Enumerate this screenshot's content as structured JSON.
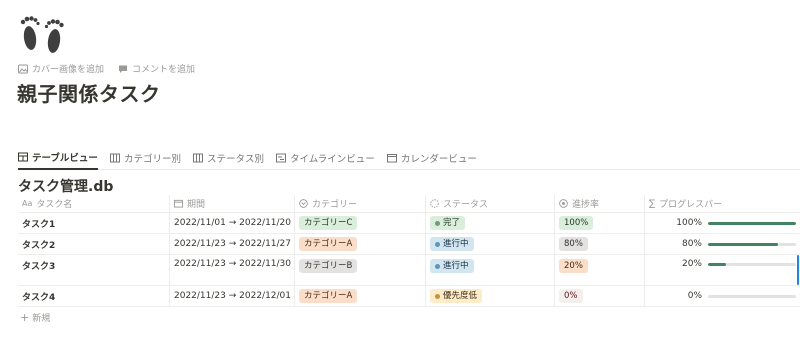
{
  "page": {
    "icon": "footprints-icon",
    "actions": {
      "add_cover": "カバー画像を追加",
      "add_comment": "コメントを追加"
    },
    "title": "親子関係タスク"
  },
  "views": [
    {
      "label": "テーブルビュー",
      "icon": "table-icon",
      "active": true
    },
    {
      "label": "カテゴリー別",
      "icon": "board-icon",
      "active": false
    },
    {
      "label": "ステータス別",
      "icon": "board-icon",
      "active": false
    },
    {
      "label": "タイムラインビュー",
      "icon": "timeline-icon",
      "active": false
    },
    {
      "label": "カレンダービュー",
      "icon": "calendar-icon",
      "active": false
    }
  ],
  "database": {
    "title": "タスク管理.db",
    "columns": [
      {
        "label": "タスク名",
        "icon": "text-aa-icon"
      },
      {
        "label": "期間",
        "icon": "calendar-icon"
      },
      {
        "label": "カテゴリー",
        "icon": "select-icon"
      },
      {
        "label": "ステータス",
        "icon": "status-icon"
      },
      {
        "label": "進捗率",
        "icon": "formula-icon"
      },
      {
        "label": "プログレスバー",
        "icon": "sigma-icon"
      }
    ],
    "rows": [
      {
        "name": "タスク1",
        "period": "2022/11/01 → 2022/11/20",
        "category": "カテゴリーC",
        "status": "完了",
        "progress_rate": "100%",
        "progress": 1.0,
        "progress_label": "100%"
      },
      {
        "name": "タスク2",
        "period": "2022/11/23 → 2022/11/27",
        "category": "カテゴリーA",
        "status": "進行中",
        "progress_rate": "80%",
        "progress": 0.8,
        "progress_label": "80%"
      },
      {
        "name": "タスク3",
        "period": "2022/11/23 → 2022/11/30",
        "category": "カテゴリーB",
        "status": "進行中",
        "progress_rate": "20%",
        "progress": 0.2,
        "progress_label": "20%"
      },
      {
        "name": "タスク4",
        "period": "2022/11/23 → 2022/12/01",
        "category": "カテゴリーA",
        "status": "優先度低",
        "progress_rate": "0%",
        "progress": 0.0,
        "progress_label": "0%"
      }
    ],
    "new_label": "新規"
  },
  "colors": {
    "category": {
      "カテゴリーC": {
        "bg": "#dbeddb",
        "fg": "#1c3829"
      },
      "カテゴリーA": {
        "bg": "#fadec9",
        "fg": "#49290e"
      },
      "カテゴリーB": {
        "bg": "#e3e2e0",
        "fg": "#32302c"
      }
    },
    "status": {
      "完了": {
        "bg": "#dbeddb",
        "fg": "#1c3829",
        "dot": "#6c9b7d"
      },
      "進行中": {
        "bg": "#d3e5ef",
        "fg": "#183347",
        "dot": "#5b97bd"
      },
      "優先度低": {
        "bg": "#fdecc8",
        "fg": "#402c1b",
        "dot": "#c29343"
      }
    },
    "rate": {
      "100%": {
        "bg": "#dbeddb",
        "fg": "#1c3829"
      },
      "80%": {
        "bg": "#e3e2e0",
        "fg": "#32302c"
      },
      "20%": {
        "bg": "#fadec9",
        "fg": "#49290e"
      },
      "0%": {
        "bg": "#f4eeee",
        "fg": "#5d1715"
      }
    },
    "progress_fill": "#448361"
  }
}
